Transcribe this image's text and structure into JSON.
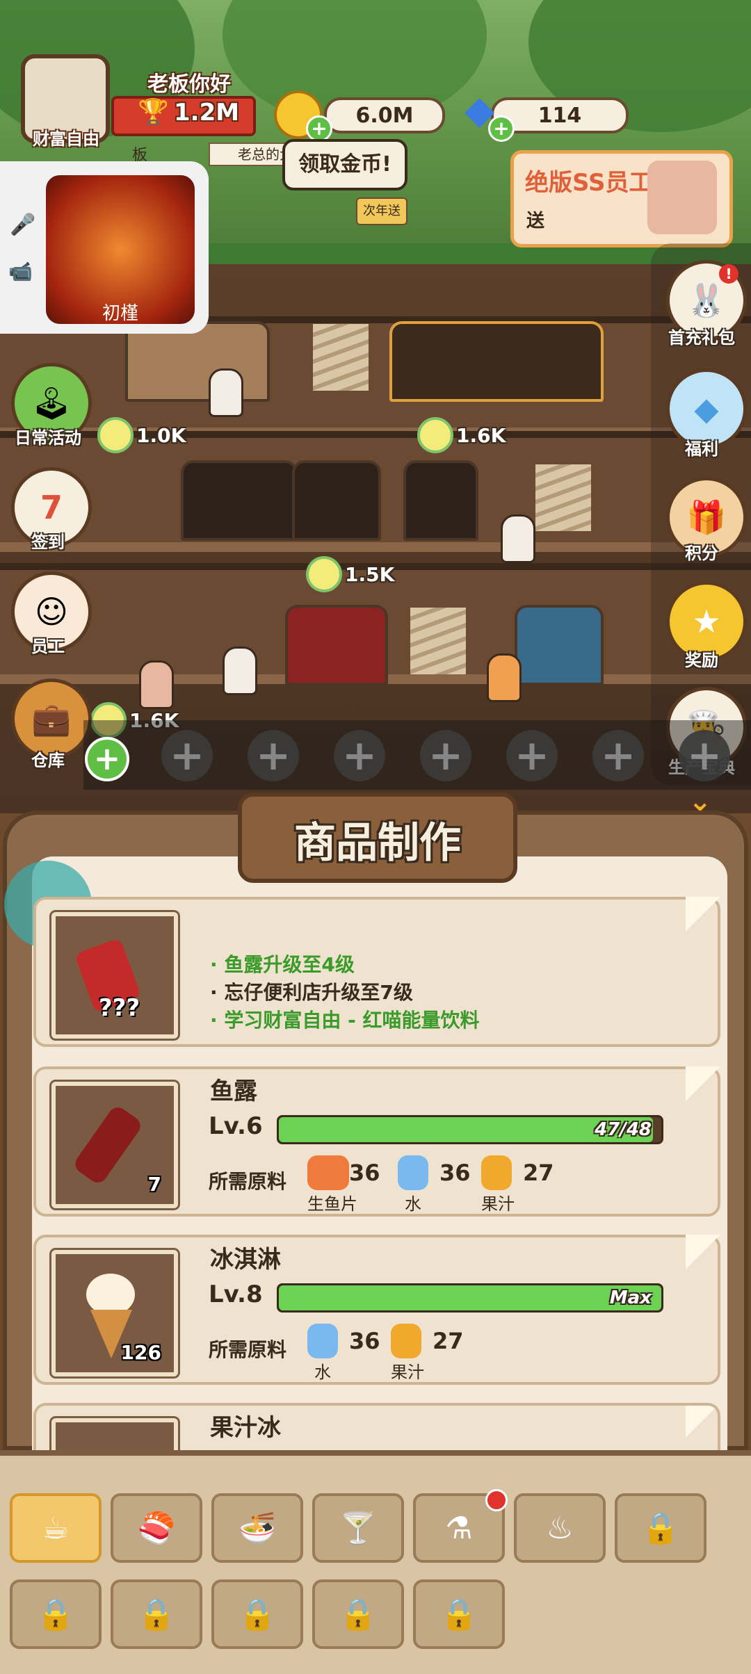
{
  "header": {
    "greeting": "老板你好",
    "profile_name": "财富自由",
    "wealth": "1.2M",
    "coins": "6.0M",
    "gems": "114",
    "claim_coins_label": "领取金币!"
  },
  "banner": {
    "text": "绝版SS员工",
    "sub": "送"
  },
  "floating_video": {
    "name": "初槿"
  },
  "shop_signs": {
    "sign1": "老总的大订",
    "sign2": "板",
    "sign3": "次年送"
  },
  "left_menu": [
    {
      "label": "日常活动"
    },
    {
      "label": "签到",
      "badge": "7"
    },
    {
      "label": "员工"
    },
    {
      "label": "仓库"
    }
  ],
  "right_menu": [
    {
      "label": "首充礼包"
    },
    {
      "label": "福利"
    },
    {
      "label": "积分"
    },
    {
      "label": "奖励"
    },
    {
      "label": "生产宝典"
    }
  ],
  "production_bubbles": [
    "1.0K",
    "1.6K",
    "1.5K",
    "1.6K"
  ],
  "panel": {
    "title": "商品制作",
    "locked_item": {
      "mystery": "???",
      "conditions": [
        "鱼露升级至4级",
        "忘仔便利店升级至7级",
        "学习财富自由 - 红喵能量饮料"
      ]
    },
    "items": [
      {
        "name": "鱼露",
        "level": "Lv.6",
        "progress_text": "47/48",
        "progress": 0.979,
        "stock": "7",
        "req_label": "所需原料",
        "materials": [
          {
            "name": "生鱼片",
            "qty": "36",
            "icon": "salmon-icon",
            "color": "#f07a3c"
          },
          {
            "name": "水",
            "qty": "36",
            "icon": "water-bottle-icon",
            "color": "#7ab8f0"
          },
          {
            "name": "果汁",
            "qty": "27",
            "icon": "juice-box-icon",
            "color": "#f0a92c"
          }
        ]
      },
      {
        "name": "冰淇淋",
        "level": "Lv.8",
        "progress_text": "Max",
        "progress": 1.0,
        "stock": "126",
        "req_label": "所需原料",
        "materials": [
          {
            "name": "水",
            "qty": "36",
            "icon": "water-bottle-icon",
            "color": "#7ab8f0"
          },
          {
            "name": "果汁",
            "qty": "27",
            "icon": "juice-box-icon",
            "color": "#f0a92c"
          }
        ]
      },
      {
        "name": "果汁冰"
      }
    ]
  },
  "tabs": [
    {
      "icon": "coffee-cup-icon",
      "glyph": "☕",
      "active": true
    },
    {
      "icon": "sushi-icon",
      "glyph": "🍣"
    },
    {
      "icon": "noodle-bowl-icon",
      "glyph": "🍜"
    },
    {
      "icon": "cocktail-icon",
      "glyph": "🍸"
    },
    {
      "icon": "flask-icon",
      "glyph": "⚗",
      "notify": true
    },
    {
      "icon": "grill-icon",
      "glyph": "♨"
    },
    {
      "icon": "lock-icon",
      "glyph": "🔒"
    },
    {
      "icon": "lock-icon",
      "glyph": "🔒"
    },
    {
      "icon": "lock-icon",
      "glyph": "🔒"
    },
    {
      "icon": "lock-icon",
      "glyph": "🔒"
    },
    {
      "icon": "lock-icon",
      "glyph": "🔒"
    },
    {
      "icon": "lock-icon",
      "glyph": "🔒"
    }
  ],
  "colors": {
    "accent": "#f3c76b",
    "progress": "#6cd254",
    "panel": "#8a6a4a"
  }
}
